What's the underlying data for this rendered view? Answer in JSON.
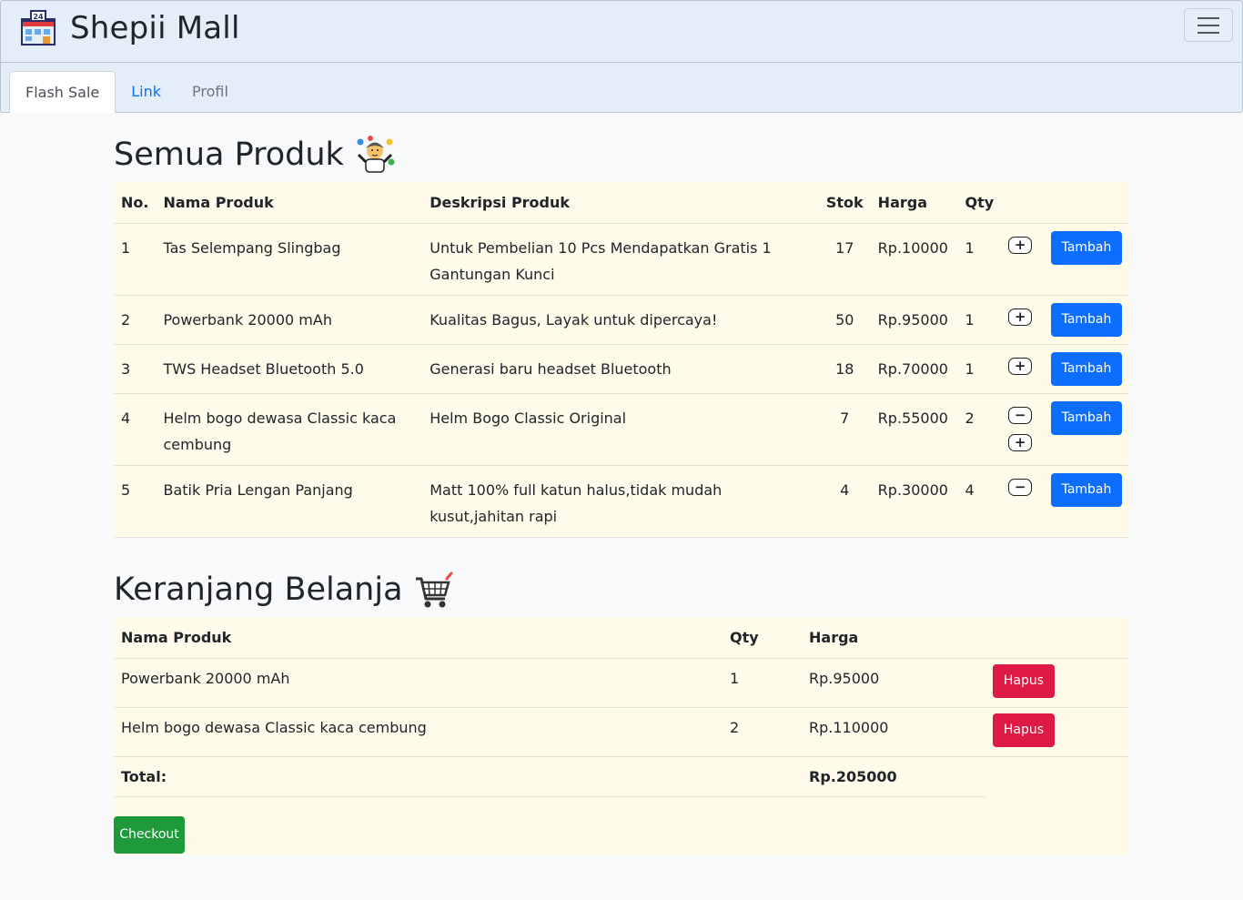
{
  "app": {
    "brand": "Shepii Mall",
    "logo_label": "24"
  },
  "nav": {
    "tabs": [
      {
        "label": "Flash Sale",
        "active": true
      },
      {
        "label": "Link",
        "active": false
      },
      {
        "label": "Profil",
        "active": false
      }
    ]
  },
  "products": {
    "heading": "Semua Produk",
    "heading_icon": "juggler-emoji-icon",
    "columns": {
      "no": "No.",
      "name": "Nama Produk",
      "desc": "Deskripsi Produk",
      "stock": "Stok",
      "price": "Harga",
      "qty": "Qty"
    },
    "rows": [
      {
        "no": "1",
        "name": "Tas Selempang Slingbag",
        "desc": "Untuk Pembelian 10 Pcs Mendapatkan Gratis 1 Gantungan Kunci",
        "stock": "17",
        "price": "Rp.10000",
        "qty": "1",
        "minus": false,
        "plus": true,
        "button": "Tambah"
      },
      {
        "no": "2",
        "name": "Powerbank 20000 mAh",
        "desc": "Kualitas Bagus, Layak untuk dipercaya!",
        "stock": "50",
        "price": "Rp.95000",
        "qty": "1",
        "minus": false,
        "plus": true,
        "button": "Tambah"
      },
      {
        "no": "3",
        "name": "TWS Headset Bluetooth 5.0",
        "desc": "Generasi baru headset Bluetooth",
        "stock": "18",
        "price": "Rp.70000",
        "qty": "1",
        "minus": false,
        "plus": true,
        "button": "Tambah"
      },
      {
        "no": "4",
        "name": "Helm bogo dewasa Classic kaca cembung",
        "desc": "Helm Bogo Classic Original",
        "stock": "7",
        "price": "Rp.55000",
        "qty": "2",
        "minus": true,
        "plus": true,
        "button": "Tambah"
      },
      {
        "no": "5",
        "name": "Batik Pria Lengan Panjang",
        "desc": "Matt 100% full katun halus,tidak mudah kusut,jahitan rapi",
        "stock": "4",
        "price": "Rp.30000",
        "qty": "4",
        "minus": true,
        "plus": false,
        "button": "Tambah"
      }
    ]
  },
  "cart": {
    "heading": "Keranjang Belanja",
    "heading_icon": "shopping-cart-emoji-icon",
    "columns": {
      "name": "Nama Produk",
      "qty": "Qty",
      "price": "Harga"
    },
    "rows": [
      {
        "name": "Powerbank 20000 mAh",
        "qty": "1",
        "price": "Rp.95000",
        "button": "Hapus"
      },
      {
        "name": "Helm bogo dewasa Classic kaca cembung",
        "qty": "2",
        "price": "Rp.110000",
        "button": "Hapus"
      }
    ],
    "total_label": "Total:",
    "total_value": "Rp.205000",
    "checkout_label": "Checkout"
  },
  "colors": {
    "navbar_bg": "#e3eef8",
    "table_bg": "#fffbea",
    "primary": "#0d6efd",
    "danger": "#dc1a43",
    "success": "#1f9a3a"
  }
}
